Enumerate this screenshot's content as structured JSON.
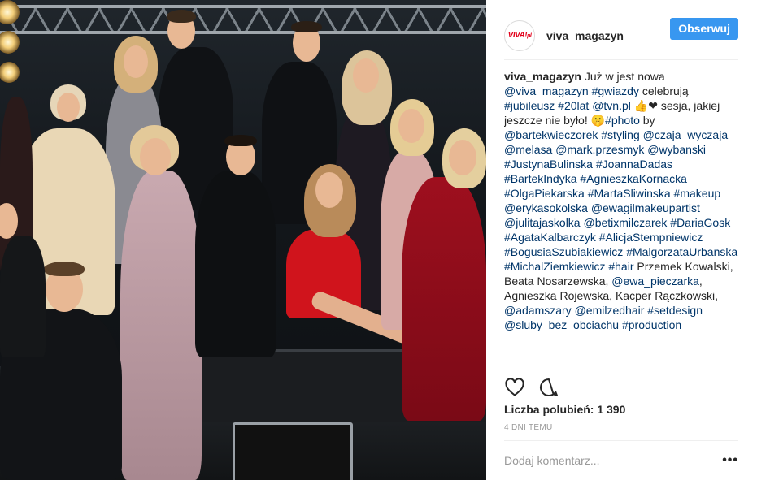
{
  "post": {
    "username": "viva_magazyn",
    "avatar_text": "VIVA!",
    "avatar_sub": "pl",
    "follow_label": "Obserwuj",
    "caption": {
      "author": "viva_magazyn",
      "segments": [
        {
          "t": "text",
          "v": " Już w jest nowa "
        },
        {
          "t": "link",
          "v": "@viva_magazyn"
        },
        {
          "t": "text",
          "v": " "
        },
        {
          "t": "link",
          "v": "#gwiazdy"
        },
        {
          "t": "text",
          "v": " celebrują "
        },
        {
          "t": "link",
          "v": "#jubileusz"
        },
        {
          "t": "text",
          "v": " "
        },
        {
          "t": "link",
          "v": "#20lat"
        },
        {
          "t": "text",
          "v": " "
        },
        {
          "t": "link",
          "v": "@tvn.pl"
        },
        {
          "t": "text",
          "v": " 👍❤ sesja, jakiej jeszcze nie było! 🤫"
        },
        {
          "t": "link",
          "v": "#photo"
        },
        {
          "t": "text",
          "v": " by "
        },
        {
          "t": "link",
          "v": "@bartekwieczorek"
        },
        {
          "t": "text",
          "v": " "
        },
        {
          "t": "link",
          "v": "#styling"
        },
        {
          "t": "text",
          "v": " "
        },
        {
          "t": "link",
          "v": "@czaja_wyczaja"
        },
        {
          "t": "text",
          "v": " "
        },
        {
          "t": "link",
          "v": "@melasa"
        },
        {
          "t": "text",
          "v": " "
        },
        {
          "t": "link",
          "v": "@mark.przesmyk"
        },
        {
          "t": "text",
          "v": " "
        },
        {
          "t": "link",
          "v": "@wybanski"
        },
        {
          "t": "text",
          "v": " "
        },
        {
          "t": "link",
          "v": "#JustynaBulinska"
        },
        {
          "t": "text",
          "v": " "
        },
        {
          "t": "link",
          "v": "#JoannaDadas"
        },
        {
          "t": "text",
          "v": " "
        },
        {
          "t": "link",
          "v": "#BartekIndyka"
        },
        {
          "t": "text",
          "v": " "
        },
        {
          "t": "link",
          "v": "#AgnieszkaKornacka"
        },
        {
          "t": "text",
          "v": " "
        },
        {
          "t": "link",
          "v": "#OlgaPiekarska"
        },
        {
          "t": "text",
          "v": " "
        },
        {
          "t": "link",
          "v": "#MartaSliwinska"
        },
        {
          "t": "text",
          "v": " "
        },
        {
          "t": "link",
          "v": "#makeup"
        },
        {
          "t": "text",
          "v": " "
        },
        {
          "t": "link",
          "v": "@erykasokolska"
        },
        {
          "t": "text",
          "v": " "
        },
        {
          "t": "link",
          "v": "@ewagilmakeupartist"
        },
        {
          "t": "text",
          "v": " "
        },
        {
          "t": "link",
          "v": "@julitajaskolka"
        },
        {
          "t": "text",
          "v": " "
        },
        {
          "t": "link",
          "v": "@betixmilczarek"
        },
        {
          "t": "text",
          "v": " "
        },
        {
          "t": "link",
          "v": "#DariaGosk"
        },
        {
          "t": "text",
          "v": " "
        },
        {
          "t": "link",
          "v": "#AgataKalbarczyk"
        },
        {
          "t": "text",
          "v": " "
        },
        {
          "t": "link",
          "v": "#AlicjaStempniewicz"
        },
        {
          "t": "text",
          "v": " "
        },
        {
          "t": "link",
          "v": "#BogusiaSzubiakiewicz"
        },
        {
          "t": "text",
          "v": " "
        },
        {
          "t": "link",
          "v": "#MalgorzataUrbanska"
        },
        {
          "t": "text",
          "v": " "
        },
        {
          "t": "link",
          "v": "#MichalZiemkiewicz"
        },
        {
          "t": "text",
          "v": " "
        },
        {
          "t": "link",
          "v": "#hair"
        },
        {
          "t": "text",
          "v": " Przemek Kowalski, Beata Nosarzewska, "
        },
        {
          "t": "link",
          "v": "@ewa_pieczarka"
        },
        {
          "t": "text",
          "v": ", Agnieszka Rojewska, Kacper Rączkowski, "
        },
        {
          "t": "link",
          "v": "@adamszary"
        },
        {
          "t": "text",
          "v": " "
        },
        {
          "t": "link",
          "v": "@emilzedhair"
        },
        {
          "t": "text",
          "v": " "
        },
        {
          "t": "link",
          "v": "#setdesign"
        },
        {
          "t": "text",
          "v": " "
        },
        {
          "t": "link",
          "v": "@sluby_bez_obciachu"
        },
        {
          "t": "text",
          "v": " "
        },
        {
          "t": "link",
          "v": "#production"
        }
      ]
    },
    "icons": {
      "like": "heart-icon",
      "comment": "comment-bubble-icon",
      "more": "more-options-icon"
    },
    "likes_label": "Liczba polubień: 1 390",
    "timestamp": "4 DNI TEMU",
    "comment_placeholder": "Dodaj komentarz...",
    "more_glyph": "•••",
    "colors": {
      "follow_button": "#3897f0",
      "link": "#003569",
      "muted": "#999999",
      "logo_red": "#e2001a"
    }
  }
}
